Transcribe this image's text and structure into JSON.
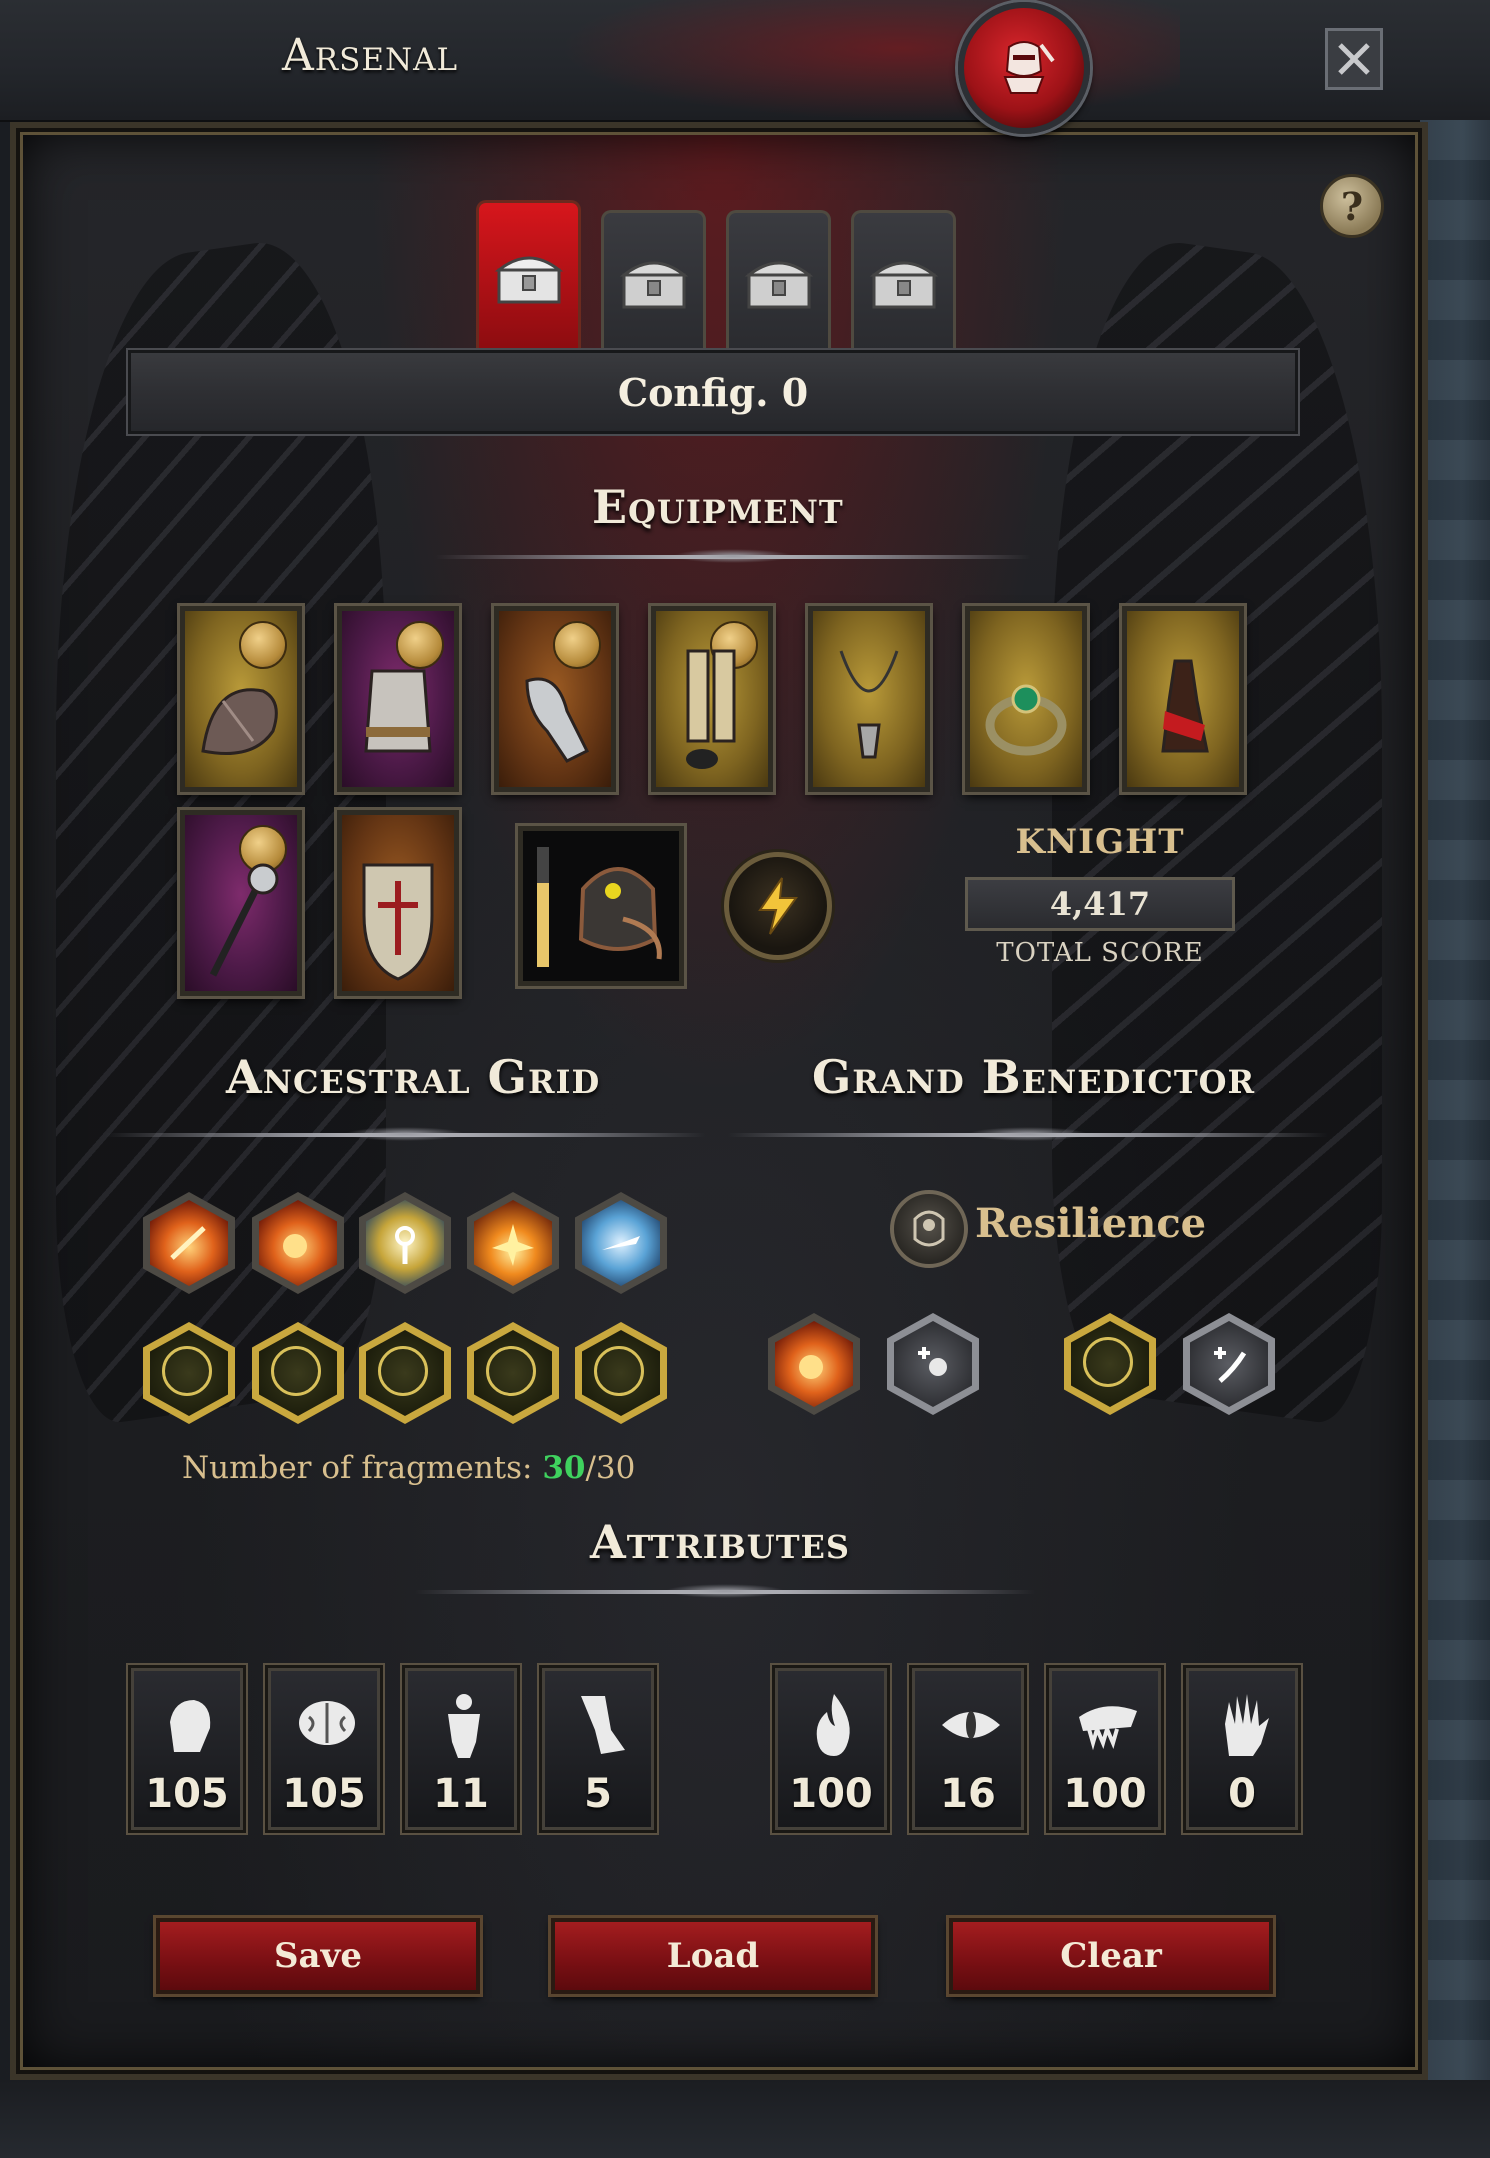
{
  "window": {
    "title": "Arsenal",
    "close_icon": "close-icon",
    "emblem_icon": "knight-helmet-icon",
    "accent": "#c0151b"
  },
  "help": {
    "label": "?"
  },
  "config": {
    "tabs": [
      {
        "icon": "chest-icon",
        "active": true
      },
      {
        "icon": "chest-icon",
        "active": false
      },
      {
        "icon": "chest-icon",
        "active": false
      },
      {
        "icon": "chest-icon",
        "active": false
      }
    ],
    "current": "Config. 0"
  },
  "equipment": {
    "heading": "Equipment",
    "slots": [
      {
        "icon": "shoulder-armor-icon",
        "rarity": "gold",
        "coin": true
      },
      {
        "icon": "chest-armor-icon",
        "rarity": "purple",
        "coin": true
      },
      {
        "icon": "gauntlets-icon",
        "rarity": "bronze",
        "coin": true
      },
      {
        "icon": "leg-armor-icon",
        "rarity": "gold",
        "coin": true
      },
      {
        "icon": "necklace-icon",
        "rarity": "gold",
        "coin": false
      },
      {
        "icon": "ring-icon",
        "rarity": "gold",
        "coin": false
      },
      {
        "icon": "belt-pouch-icon",
        "rarity": "gold",
        "coin": false
      },
      {
        "icon": "mace-icon",
        "rarity": "purple",
        "coin": true
      },
      {
        "icon": "shield-icon",
        "rarity": "bronze",
        "coin": false
      }
    ],
    "spirit_icon": "helmet-spirit-icon",
    "power_icon": "lightning-icon",
    "class_name": "KNIGHT",
    "total_score": "4,417",
    "total_score_label": "TOTAL SCORE"
  },
  "ancestral_grid": {
    "heading": "Ancestral Grid",
    "top_row": [
      "fire-slash-icon",
      "fireball-icon",
      "holy-cross-icon",
      "explosion-icon",
      "ice-blade-icon"
    ],
    "bottom_row": [
      "rune-icon",
      "rune-icon",
      "rune-icon",
      "rune-icon",
      "rune-icon"
    ],
    "fragments_label": "Number of fragments:",
    "fragments_current": "30",
    "fragments_max": "/30"
  },
  "grand_benedictor": {
    "heading": "Grand Benedictor",
    "blessing_icon": "head-shield-icon",
    "blessing_name": "Resilience",
    "slots": [
      "fireball-icon",
      "plus-figure-icon",
      "rune-icon",
      "plus-claw-icon"
    ]
  },
  "attributes": {
    "heading": "Attributes",
    "items": [
      {
        "icon": "fist-icon",
        "value": "105"
      },
      {
        "icon": "brain-icon",
        "value": "105"
      },
      {
        "icon": "body-icon",
        "value": "11"
      },
      {
        "icon": "leg-icon",
        "value": "5"
      },
      {
        "icon": "flame-icon",
        "value": "100"
      },
      {
        "icon": "eye-icon",
        "value": "16"
      },
      {
        "icon": "fangs-icon",
        "value": "100"
      },
      {
        "icon": "hand-icon",
        "value": "0"
      }
    ]
  },
  "actions": {
    "save": "Save",
    "load": "Load",
    "clear": "Clear"
  }
}
